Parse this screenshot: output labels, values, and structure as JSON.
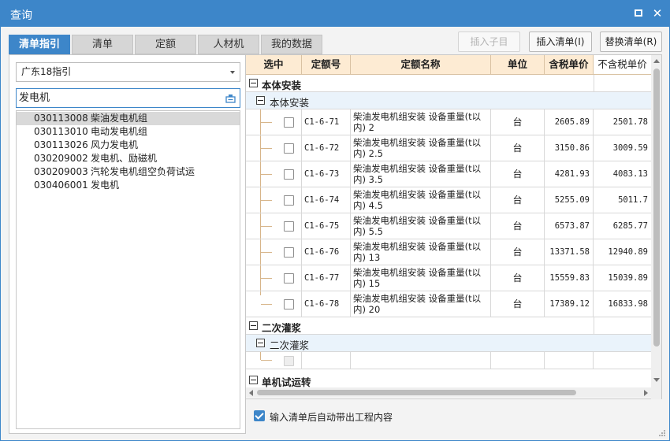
{
  "window": {
    "title": "查询"
  },
  "tabs": [
    {
      "label": "清单指引",
      "active": true
    },
    {
      "label": "清单",
      "active": false
    },
    {
      "label": "定额",
      "active": false
    },
    {
      "label": "人材机",
      "active": false
    },
    {
      "label": "我的数据",
      "active": false
    }
  ],
  "toolbar": {
    "insert_child": "插入子目",
    "insert_list": "插入清单(I)",
    "replace_list": "替换清单(R)"
  },
  "left": {
    "library": "广东18指引",
    "search_value": "发电机",
    "items": [
      {
        "code": "030113008",
        "name": "柴油发电机组",
        "selected": true
      },
      {
        "code": "030113010",
        "name": "电动发电机组",
        "selected": false
      },
      {
        "code": "030113026",
        "name": "风力发电机",
        "selected": false
      },
      {
        "code": "030209002",
        "name": "发电机、励磁机",
        "selected": false
      },
      {
        "code": "030209003",
        "name": "汽轮发电机组空负荷试运",
        "selected": false
      },
      {
        "code": "030406001",
        "name": "发电机",
        "selected": false
      }
    ]
  },
  "grid": {
    "headers": [
      "选中",
      "定额号",
      "定额名称",
      "单位",
      "含税单价",
      "不含税单价"
    ],
    "groups": [
      {
        "title": "本体安装",
        "sub": "本体安装",
        "rows": [
          {
            "code": "C1-6-71",
            "name1": "柴油发电机组安装 设备重量(t以",
            "name2": "内) 2",
            "unit": "台",
            "price_tax": "2605.89",
            "price_notax": "2501.78"
          },
          {
            "code": "C1-6-72",
            "name1": "柴油发电机组安装 设备重量(t以",
            "name2": "内) 2.5",
            "unit": "台",
            "price_tax": "3150.86",
            "price_notax": "3009.59"
          },
          {
            "code": "C1-6-73",
            "name1": "柴油发电机组安装 设备重量(t以",
            "name2": "内) 3.5",
            "unit": "台",
            "price_tax": "4281.93",
            "price_notax": "4083.13"
          },
          {
            "code": "C1-6-74",
            "name1": "柴油发电机组安装 设备重量(t以",
            "name2": "内) 4.5",
            "unit": "台",
            "price_tax": "5255.09",
            "price_notax": "5011.7"
          },
          {
            "code": "C1-6-75",
            "name1": "柴油发电机组安装 设备重量(t以",
            "name2": "内) 5.5",
            "unit": "台",
            "price_tax": "6573.87",
            "price_notax": "6285.77"
          },
          {
            "code": "C1-6-76",
            "name1": "柴油发电机组安装 设备重量(t以",
            "name2": "内) 13",
            "unit": "台",
            "price_tax": "13371.58",
            "price_notax": "12940.89"
          },
          {
            "code": "C1-6-77",
            "name1": "柴油发电机组安装 设备重量(t以",
            "name2": "内) 15",
            "unit": "台",
            "price_tax": "15559.83",
            "price_notax": "15039.89"
          },
          {
            "code": "C1-6-78",
            "name1": "柴油发电机组安装 设备重量(t以",
            "name2": "内) 20",
            "unit": "台",
            "price_tax": "17389.12",
            "price_notax": "16833.98"
          }
        ]
      },
      {
        "title": "二次灌浆",
        "sub": "二次灌浆"
      },
      {
        "title": "单机试运转"
      }
    ]
  },
  "footer": {
    "auto_bring_label": "输入清单后自动带出工程内容",
    "checked": true
  },
  "colors": {
    "accent": "#3d86c9",
    "header_bg": "#fdebd3",
    "sub_row_bg": "#eaf3fb"
  }
}
